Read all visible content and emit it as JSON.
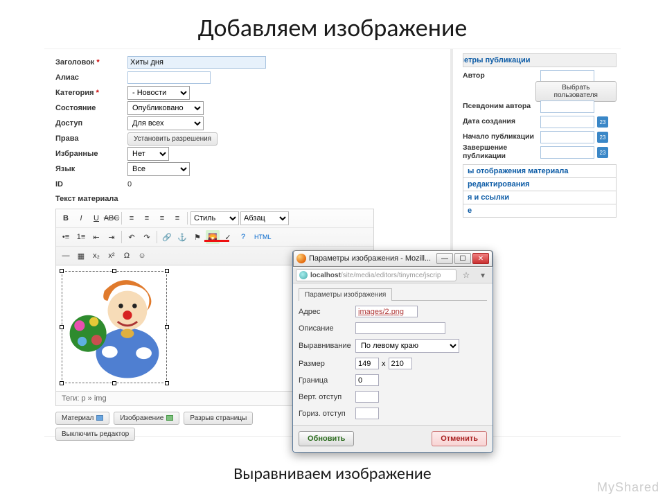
{
  "slide": {
    "title": "Добавляем изображение",
    "caption": "Выравниваем изображение",
    "watermark": "MyShared"
  },
  "form": {
    "header_label": "Заголовок",
    "header_value": "Хиты дня",
    "alias_label": "Алиас",
    "category_label": "Категория",
    "category_value": "- Новости",
    "state_label": "Состояние",
    "state_value": "Опубликовано",
    "access_label": "Доступ",
    "access_value": "Для всех",
    "rights_label": "Права",
    "rights_btn": "Установить разрешения",
    "featured_label": "Избранные",
    "featured_value": "Нет",
    "lang_label": "Язык",
    "lang_value": "Все",
    "id_label": "ID",
    "id_value": "0",
    "text_label": "Текст материала",
    "tags": "Теги: p » img"
  },
  "toolbar": {
    "style": "Стиль",
    "para": "Абзац",
    "html": "HTML"
  },
  "bottom_buttons": {
    "material": "Материал",
    "image": "Изображение",
    "pagebreak": "Разрыв страницы",
    "editor_off": "Выключить редактор"
  },
  "right": {
    "head1": "Параметры публикации",
    "author_label": "Автор",
    "pick_user": "Выбрать пользователя",
    "pseudonym_label": "Псевдоним автора",
    "created_label": "Дата создания",
    "pub_start_label": "Начало публикации",
    "pub_end_label": "Завершение публикации",
    "head2": "ы отображения материала",
    "head3": "редактирования",
    "head4": "я и ссылки",
    "head5": "e"
  },
  "popup": {
    "title": "Параметры изображения - Mozill...",
    "url_host": "localhost",
    "url_path": "/site/media/editors/tinymce/jscrip",
    "tab": "Параметры изображения",
    "addr_label": "Адрес",
    "addr_value": "images/2.png",
    "desc_label": "Описание",
    "align_label": "Выравнивание",
    "align_value": "По левому краю",
    "size_label": "Размер",
    "size_w": "149",
    "size_x": "x",
    "size_h": "210",
    "border_label": "Граница",
    "border_value": "0",
    "vspace_label": "Верт. отступ",
    "hspace_label": "Гориз. отступ",
    "ok": "Обновить",
    "cancel": "Отменить"
  }
}
